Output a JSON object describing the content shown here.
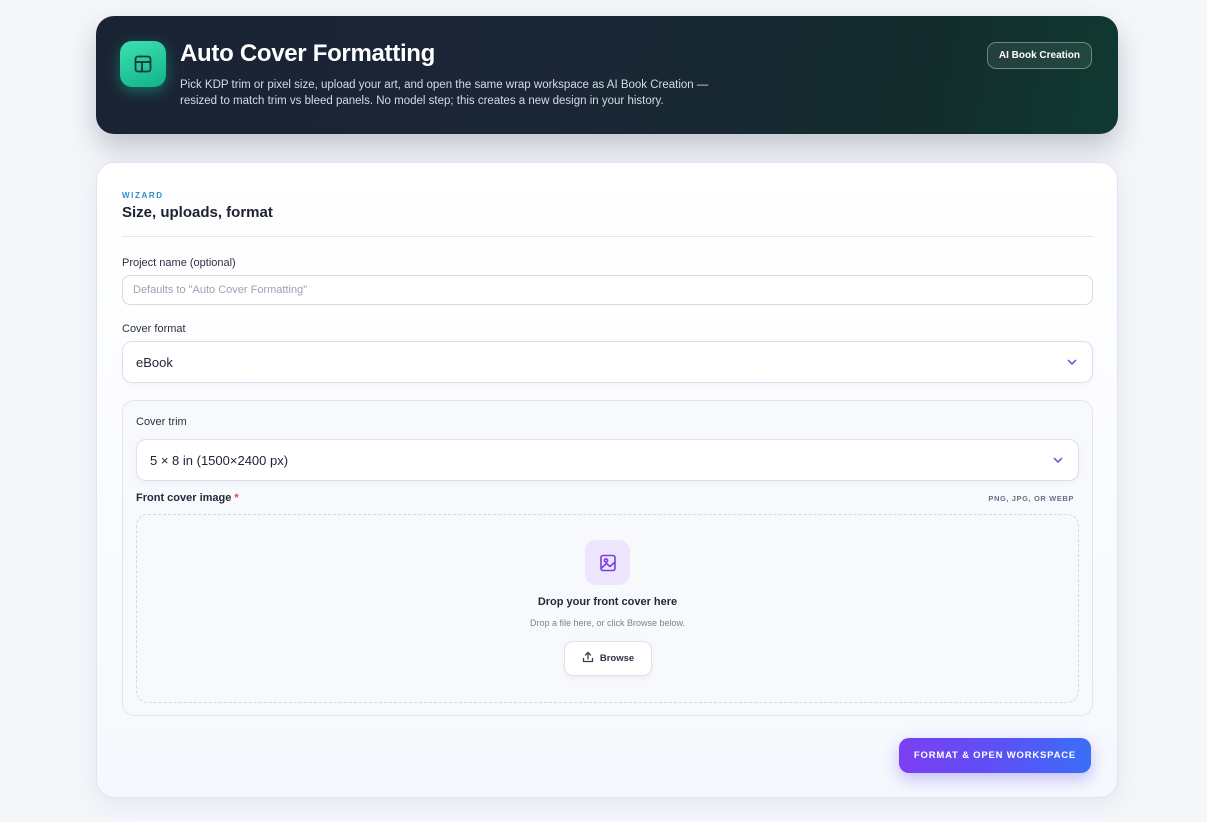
{
  "header": {
    "title": "Auto Cover Formatting",
    "description": "Pick KDP trim or pixel size, upload your art, and open the same wrap workspace as AI Book Creation — resized to match trim vs bleed panels. No model step; this creates a new design in your history.",
    "badge": "AI Book Creation",
    "icon": "layout-icon"
  },
  "wizard": {
    "eyebrow": "WIZARD",
    "title": "Size, uploads, format",
    "project_name": {
      "label": "Project name (optional)",
      "placeholder": "Defaults to \"Auto Cover Formatting\"",
      "value": ""
    },
    "cover_format": {
      "label": "Cover format",
      "value": "eBook"
    },
    "cover_trim": {
      "label": "Cover trim",
      "value": "5 × 8 in (1500×2400 px)"
    },
    "front_cover": {
      "label": "Front cover image",
      "required_mark": "*",
      "formats": "PNG, JPG, OR WEBP",
      "drop_title": "Drop your front cover here",
      "drop_subtitle": "Drop a file here, or click Browse below.",
      "browse_label": "Browse"
    },
    "submit_label": "FORMAT & OPEN WORKSPACE"
  },
  "colors": {
    "accent_purple": "#7b3ff2",
    "accent_blue": "#3a6ff7",
    "icon_green": "#10b48a",
    "eyebrow_blue": "#2c8fc7",
    "required_red": "#e0474c"
  }
}
